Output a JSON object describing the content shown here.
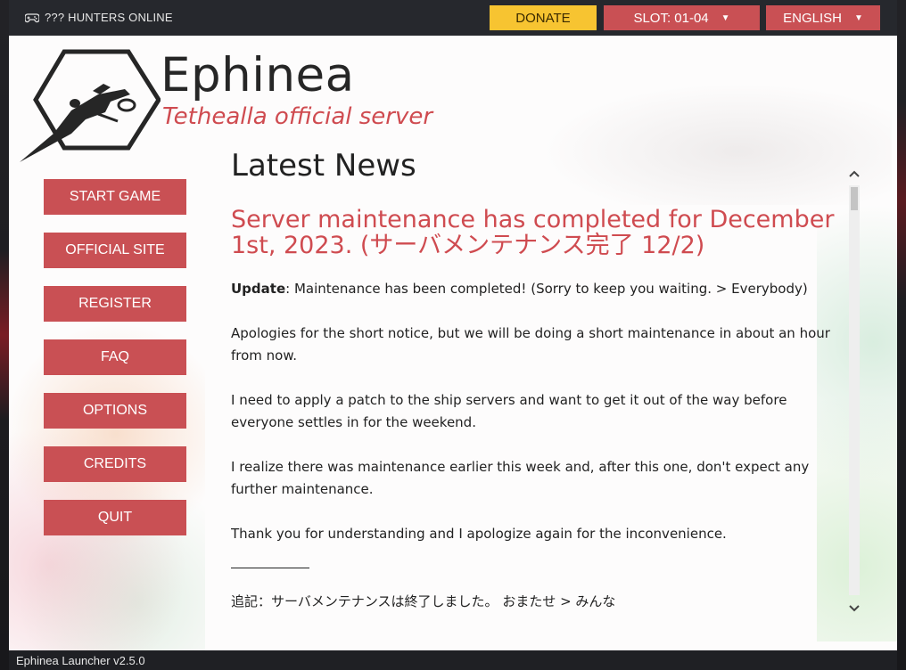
{
  "topbar": {
    "players_text": "??? HUNTERS ONLINE",
    "players_icon": "gamepad-icon",
    "donate_label": "DONATE",
    "slot_label": "SLOT: 01-04",
    "language_label": "ENGLISH",
    "caret": "▼"
  },
  "brand": {
    "title": "Ephinea",
    "subtitle": "Tethealla official server",
    "logo_icon": "ship-hexagon-logo"
  },
  "nav": {
    "items": [
      {
        "label": "START GAME"
      },
      {
        "label": "OFFICIAL SITE"
      },
      {
        "label": "REGISTER"
      },
      {
        "label": "FAQ"
      },
      {
        "label": "OPTIONS"
      },
      {
        "label": "CREDITS"
      },
      {
        "label": "QUIT"
      }
    ]
  },
  "news": {
    "heading": "Latest News",
    "article_title": "Server maintenance has completed for December 1st, 2023. (サーバメンテナンス完了 12/2)",
    "update_label": "Update",
    "update_text": ": Maintenance has been completed! (Sorry to keep you waiting. > Everybody)",
    "paragraphs": [
      "Apologies for the short notice, but we will be doing a short maintenance in about an hour from now.",
      "I need to apply a patch to the ship servers and want to get it out of the way before everyone settles in for the weekend.",
      "I realize there was maintenance earlier this week and, after this one, don't expect any further maintenance.",
      "Thank you for understanding and I apologize again for the inconvenience."
    ],
    "jp_note": "追記：サーバメンテナンスは終了しました。 おまたせ > みんな"
  },
  "scrollbar": {
    "up": "⌃",
    "down": "⌄"
  },
  "footer": {
    "version": "Ephinea Launcher v2.5.0"
  },
  "colors": {
    "accent": "#c95054",
    "donate": "#f7c431",
    "title_red": "#cf4b50",
    "topbar": "#26282d"
  }
}
